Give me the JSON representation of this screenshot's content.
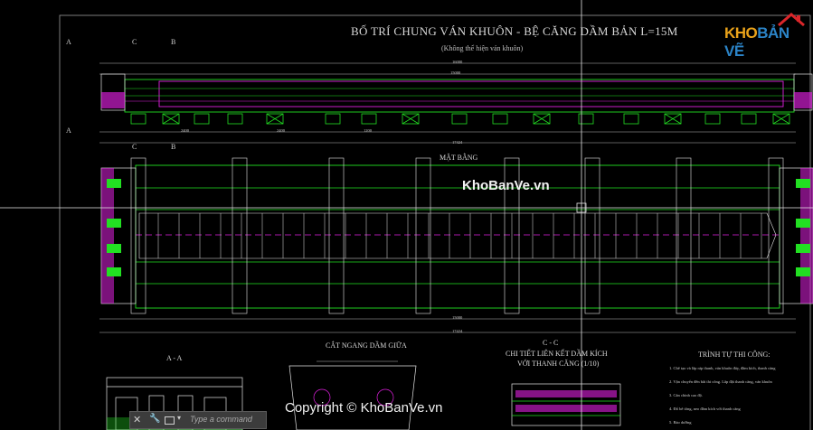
{
  "drawing": {
    "title": "BỐ TRÍ CHUNG VÁN KHUÔN - BỆ CĂNG DẦM BẢN L=15M",
    "subtitle": "(Không thể hiện ván khuôn)",
    "plan_label": "MẶT BẰNG",
    "section_aa": "A - A",
    "cross_section_label": "CẮT NGANG DẦM GIỮA",
    "section_cc": "C - C",
    "detail_line1": "CHI TIẾT LIÊN KẾT DẦM KÍCH",
    "detail_line2": "VỚI THANH CĂNG (1/10)",
    "procedure_title": "TRÌNH TỰ THI CÔNG:",
    "procedure_steps": [
      "1. Chế tạo và lắp ráp thanh, ván khuôn đáy, đầm kích, thanh căng",
      "2. Vận chuyển đến bãi thi công. Lắp đặt thanh căng, ván khuôn",
      "3. Căn chỉnh cao độ.",
      "4. Đổ bê tông, neo đầm kích với thanh căng",
      "5. Bảo dưỡng"
    ],
    "section_markers": [
      "A",
      "C",
      "B",
      "A",
      "C",
      "B"
    ],
    "dimension_labels": [
      "16000",
      "15000",
      "17424",
      "15000",
      "17424",
      "2400",
      "2400",
      "1200"
    ]
  },
  "watermark": {
    "logo_k": "KHO",
    "logo_b": "BẢN VẼ",
    "center": "KhoBanVe.vn",
    "copyright": "Copyright © KhoBanVe.vn"
  },
  "command_line": {
    "placeholder": "Type a command"
  },
  "icons": [
    "close-icon",
    "wrench-icon",
    "box-icon",
    "dropdown-icon"
  ],
  "colors": {
    "background": "#000000",
    "green": "#22e022",
    "magenta": "#e020e0",
    "white": "#e6e6e6",
    "yellow": "#e8e800"
  }
}
